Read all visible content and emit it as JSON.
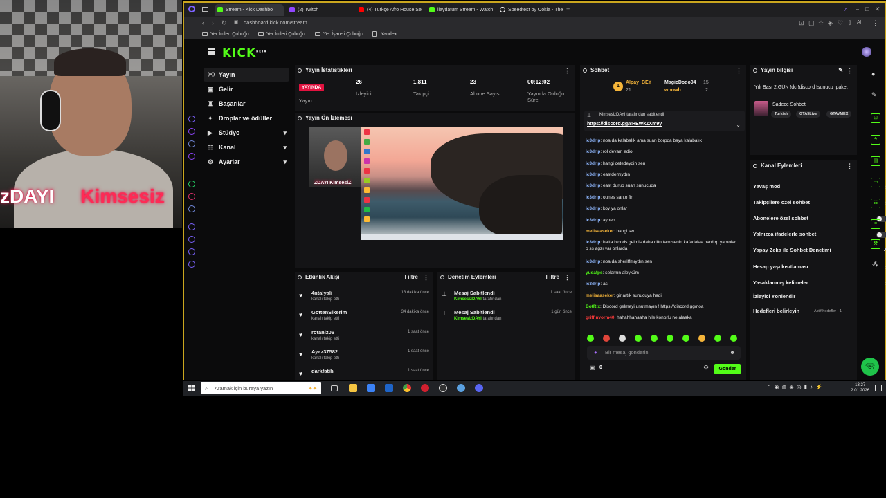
{
  "webcam": {
    "caption_left": "zDAYI",
    "caption_right": "Kimsesiz"
  },
  "browser": {
    "tabs": [
      {
        "label": "Stream - Kick Dashbo",
        "icon": "kick-icon",
        "color": "#53fc18"
      },
      {
        "label": "(2) Twitch",
        "icon": "twitch-icon",
        "color": "#9146ff"
      },
      {
        "label": "(4) Türkçe Afro House Se",
        "icon": "youtube-icon",
        "color": "#ff0000"
      },
      {
        "label": "ilaydatum Stream - Watch",
        "icon": "kick-icon",
        "color": "#53fc18"
      },
      {
        "label": "Speedtest by Ookla - The",
        "icon": "speedtest-icon",
        "color": "#ffffff"
      }
    ],
    "address": "dashboard.kick.com/stream",
    "ai_label": "AI",
    "bookmarks": [
      "Yer İmleri Çubuğu...",
      "Yer İmleri Çubuğu...",
      "Yer İşareti Çubuğu...",
      "Yandex"
    ]
  },
  "sidebar": {
    "logo": "KICK",
    "logo_sup": "BETA",
    "items": [
      {
        "label": "Yayın",
        "icon": "broadcast-icon",
        "glyph": "((•))"
      },
      {
        "label": "Gelir",
        "icon": "money-icon",
        "glyph": "▣"
      },
      {
        "label": "Başarılar",
        "icon": "trophy-icon",
        "glyph": "♜"
      },
      {
        "label": "Droplar ve ödüller",
        "icon": "gift-icon",
        "glyph": "✦"
      },
      {
        "label": "Stüdyo",
        "icon": "studio-icon",
        "glyph": "▶"
      },
      {
        "label": "Kanal",
        "icon": "channel-icon",
        "glyph": "☷"
      },
      {
        "label": "Ayarlar",
        "icon": "gear-icon",
        "glyph": "⚙"
      }
    ],
    "chevron": "▾"
  },
  "stats": {
    "title": "Yayın İstatistikleri",
    "live": "YAYINDA",
    "items": [
      {
        "value": "",
        "label": "Yayın"
      },
      {
        "value": "26",
        "label": "İzleyici"
      },
      {
        "value": "1.811",
        "label": "Takipçi"
      },
      {
        "value": "23",
        "label": "Abone Sayısı"
      },
      {
        "value": "00:12:02",
        "label": "Yayında Olduğu Süre"
      }
    ]
  },
  "preview": {
    "title": "Yayın Ön İzlemesi",
    "cam_caption": "ZDAYI    KimsesiZ"
  },
  "activity": {
    "title": "Etkinlik Akışı",
    "filter": "Filtre",
    "items": [
      {
        "name": "4ntalyali",
        "sub": "kanalı takip etti",
        "time": "13 dakika önce"
      },
      {
        "name": "GottenSikerim",
        "sub": "kanalı takip etti",
        "time": "34 dakika önce"
      },
      {
        "name": "rotaniz06",
        "sub": "kanalı takip etti",
        "time": "1 saat önce"
      },
      {
        "name": "Ayaz37582",
        "sub": "kanalı takip etti",
        "time": "1 saat önce"
      },
      {
        "name": "darkfatih",
        "sub": "",
        "time": "1 saat önce"
      }
    ]
  },
  "moderation": {
    "title": "Denetim Eylemleri",
    "filter": "Filtre",
    "items": [
      {
        "name": "Mesaj Sabitlendi",
        "user": "KimsesizDAYI",
        "suffix": "tarafından",
        "time": "1 saat önce"
      },
      {
        "name": "Mesaj Sabitlendi",
        "user": "KimsesizDAYI",
        "suffix": "tarafından",
        "time": "1 gün önce"
      }
    ]
  },
  "chat": {
    "title": "Sohbet",
    "leaders": [
      {
        "rank": "1",
        "name": "Alpay_BEY",
        "count": "21"
      },
      {
        "name": "MagicDodo04",
        "count": "15"
      },
      {
        "name": "whowh",
        "count": "2"
      }
    ],
    "pinned_by": "KimsesizDAYI tarafından sabitlendi",
    "pinned_link": "https://discord.gg/8HEWkZXm9y",
    "messages": [
      {
        "user": "ic3drip",
        "color": "#8fb8ff",
        "text": "noa da kalabalık ama suan borpda baya kalabalık"
      },
      {
        "user": "ic3drip",
        "color": "#8fb8ff",
        "text": "rol devam edio"
      },
      {
        "user": "ic3drip",
        "color": "#8fb8ff",
        "text": "hangi cetedeydin sen"
      },
      {
        "user": "ic3drip",
        "color": "#8fb8ff",
        "text": "eastdemıydın"
      },
      {
        "user": "ic3drip",
        "color": "#8fb8ff",
        "text": "east duruo suan sunucuda"
      },
      {
        "user": "ic3drip",
        "color": "#8fb8ff",
        "text": "ounes santo fln"
      },
      {
        "user": "ic3drip",
        "color": "#8fb8ff",
        "text": "koy ya onlar"
      },
      {
        "user": "ic3drip",
        "color": "#8fb8ff",
        "text": "aynen"
      },
      {
        "user": "melisaaseker",
        "color": "#f5b53a",
        "text": "hangi sw"
      },
      {
        "user": "ic3drip",
        "color": "#8fb8ff",
        "text": "hatta bloods gelmis daha dün tam senin kafadalae hard rp yapıolar o ss agzı var onlarda"
      },
      {
        "user": "ic3drip",
        "color": "#8fb8ff",
        "text": "noa da sheriffmıydın sen"
      },
      {
        "user": "yusafps",
        "color": "#53fc18",
        "text": "selamın aleyküm"
      },
      {
        "user": "ic3drip",
        "color": "#8fb8ff",
        "text": "as"
      },
      {
        "user": "melisaaseker",
        "color": "#f5b53a",
        "text": "gir artık sunucuya hadi"
      },
      {
        "user": "BotRix",
        "color": "#53fc18",
        "text": "Discord gelmeyi unutmayın ! https://discord.gg/noa"
      },
      {
        "user": "griffinvorm40",
        "color": "#ff3b3b",
        "text": "hahahhahaaha hile konorlu ne alaaka"
      }
    ],
    "input_placeholder": "Bir mesaj gönderin",
    "count": "0",
    "send": "Gönder"
  },
  "stream_info": {
    "title": "Yayın bilgisi",
    "stream_title": "Yılı Bası 2.GÜN !dc !discord !sunucu !paket",
    "category": "Sadece Sohbet",
    "tags": [
      "Turkish",
      "GTA5Live",
      "GTAVMEX"
    ]
  },
  "channel_actions": {
    "title": "Kanal Eylemleri",
    "items": [
      {
        "label": "Yavaş mod",
        "control": "›"
      },
      {
        "label": "Takipçilere özel sohbet",
        "control": "›"
      },
      {
        "label": "Abonelere özel sohbet",
        "control": "toggle"
      },
      {
        "label": "Yalnızca ifadelerle sohbet",
        "control": "toggle"
      },
      {
        "label": "Yapay Zeka ile Sohbet Denetimi",
        "control": "↗"
      },
      {
        "label": "Hesap yaşı kısıtlaması",
        "control": "›"
      },
      {
        "label": "Yasaklanmış kelimeler",
        "control": "›"
      },
      {
        "label": "İzleyici Yönlendir",
        "control": ""
      },
      {
        "label": "Hedefleri belirleyin",
        "control": "›"
      }
    ],
    "goal_badge": "Aktif hedefler · 1"
  },
  "taskbar": {
    "search_placeholder": "Aramak için buraya yazın",
    "time": "13:27",
    "date": "2.01.2026"
  }
}
